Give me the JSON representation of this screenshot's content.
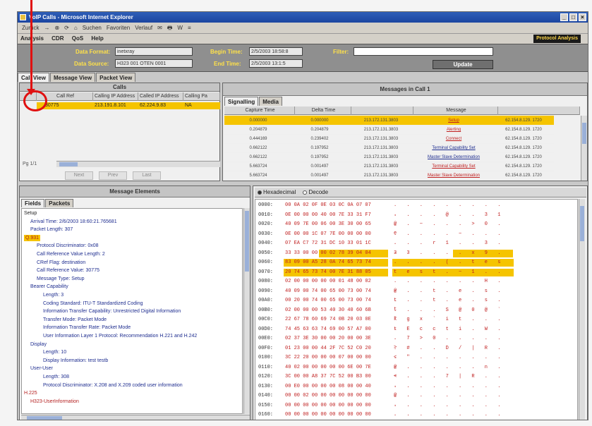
{
  "window": {
    "title": "VoIP Calls - Microsoft Internet Explorer",
    "controls": [
      "_",
      "□",
      "×"
    ]
  },
  "ie_toolbar": {
    "items": [
      "Zurück",
      "→",
      "⊗",
      "⟳",
      "⌂",
      "Suchen",
      "Favoriten",
      "Verlauf",
      "✉",
      "🖶",
      "W",
      "≡"
    ]
  },
  "menu": {
    "items": [
      "Analysis",
      "CDR",
      "QoS",
      "Help"
    ]
  },
  "brand": "Protocol Analysis",
  "filter": {
    "data_format_label": "Data Format:",
    "data_format_value": "inetxray",
    "data_source_label": "Data Source:",
    "data_source_value": "H323 001 OTEN 0001",
    "begin_time_label": "Begin Time:",
    "begin_time_value": "2/5/2003 18:58:8",
    "end_time_label": "End Time:",
    "end_time_value": "2/5/2003 13:1:5",
    "filter_label": "Filter:",
    "filter_value": "",
    "update_label": "Update"
  },
  "view_tabs": [
    "Call View",
    "Message View",
    "Packet View"
  ],
  "calls": {
    "title": "Calls",
    "columns": [
      "",
      "Call Ref",
      "Calling IP Address",
      "Called IP Address",
      "Calling Pa"
    ],
    "rows": [
      [
        "",
        "30775",
        "213.191.8.101",
        "62.224.9.83",
        "NA"
      ]
    ],
    "page_label": "Pg 1/1",
    "nav_buttons": [
      "Next",
      "Prev",
      "Last"
    ]
  },
  "messages": {
    "title": "Messages in Call 1",
    "tabs": [
      "Signalling",
      "Media"
    ],
    "columns": [
      "Capture Time",
      "Delta Time",
      "",
      "Message",
      ""
    ],
    "rows": [
      {
        "t": "0.000000",
        "d": "0.000000",
        "src": "213.172.131.3803",
        "msg": "Setup",
        "dst": "62.154.8.129. 1720",
        "color": "#c02020"
      },
      {
        "t": "0.204879",
        "d": "0.204879",
        "src": "213.172.131.3803",
        "msg": "Alerting",
        "dst": "62.154.8.129. 1720",
        "color": "#c02020"
      },
      {
        "t": "0.444169",
        "d": "0.239402",
        "src": "213.172.131.3803",
        "msg": "Connect",
        "dst": "62.154.8.129. 1720",
        "color": "#c02020"
      },
      {
        "t": "0.662122",
        "d": "0.197952",
        "src": "213.172.131.3803",
        "msg": "Terminal Capability Set",
        "dst": "62.154.8.129. 1720",
        "color": "#1e2d8f"
      },
      {
        "t": "0.662122",
        "d": "0.197952",
        "src": "213.172.131.3803",
        "msg": "Master Slave Determination",
        "dst": "62.154.8.129. 1720",
        "color": "#1e2d8f"
      },
      {
        "t": "5.663724",
        "d": "0.001497",
        "src": "213.172.131.3803",
        "msg": "Terminal Capability Set",
        "dst": "62.154.8.129. 1720",
        "color": "#c02020"
      },
      {
        "t": "5.663724",
        "d": "0.001497",
        "src": "213.172.131.3803",
        "msg": "Master Slave Determination",
        "dst": "62.154.8.129. 1720",
        "color": "#c02020"
      }
    ]
  },
  "elements": {
    "title": "Message Elements",
    "tabs": [
      "Fields",
      "Packets"
    ],
    "tree": [
      {
        "indent": 0,
        "text": "Setup",
        "tone": "dark"
      },
      {
        "indent": 1,
        "text": "Arrival Time: 2/6/2003 18:60:21.765681",
        "tone": "blue"
      },
      {
        "indent": 1,
        "text": "Packet Length: 307",
        "tone": "blue"
      },
      {
        "indent": 0,
        "text": "Q.931",
        "tone": "red"
      },
      {
        "indent": 2,
        "text": "Protocol Discriminator: 0x08",
        "tone": "blue"
      },
      {
        "indent": 2,
        "text": "Call Reference Value Length: 2",
        "tone": "blue"
      },
      {
        "indent": 2,
        "text": "CRef Flag: destination",
        "tone": "blue"
      },
      {
        "indent": 2,
        "text": "Call Reference Value: 30775",
        "tone": "blue"
      },
      {
        "indent": 2,
        "text": "Message Type: Setup",
        "tone": "blue"
      },
      {
        "indent": 1,
        "text": "Bearer Capability",
        "tone": "blue"
      },
      {
        "indent": 3,
        "text": "Length: 3",
        "tone": "blue"
      },
      {
        "indent": 3,
        "text": "Coding Standard: ITU-T Standardized Coding",
        "tone": "blue"
      },
      {
        "indent": 3,
        "text": "Information Transfer Capability: Unrestricted Digital Information",
        "tone": "blue"
      },
      {
        "indent": 3,
        "text": "Transfer Mode: Packet Mode",
        "tone": "blue"
      },
      {
        "indent": 3,
        "text": "Information Transfer Rate: Packet Mode",
        "tone": "blue"
      },
      {
        "indent": 3,
        "text": "User Information Layer 1 Protocol: Recommendation H.221 and H.242",
        "tone": "blue"
      },
      {
        "indent": 1,
        "text": "Display",
        "tone": "blue"
      },
      {
        "indent": 3,
        "text": "Length: 10",
        "tone": "blue"
      },
      {
        "indent": 3,
        "text": "Display Information: test testb",
        "tone": "blue"
      },
      {
        "indent": 1,
        "text": "User-User",
        "tone": "blue"
      },
      {
        "indent": 3,
        "text": "Length: 308",
        "tone": "blue"
      },
      {
        "indent": 3,
        "text": "Protocol Discriminator: X.208 and X.209 coded user information",
        "tone": "blue"
      },
      {
        "indent": 0,
        "text": "H.225",
        "tone": "red"
      },
      {
        "indent": 1,
        "text": "H323-UserInformation",
        "tone": "red"
      }
    ]
  },
  "hexview": {
    "radios": [
      "Hexadecimal",
      "Decode"
    ],
    "lines": [
      {
        "off": "0000:",
        "hx": "00 0A 02 0F 0E 03 0C 0A 07 07",
        "asc": ". . . . . . . . . ."
      },
      {
        "off": "0010:",
        "hx": "0E 00 00 00 40 00 7E 33 31 F7",
        "asc": ". . . . @ . . 3 1 ."
      },
      {
        "off": "0020:",
        "hx": "40 09 7E 00 06 00 3E 30 00 65",
        "asc": "@ . ~ . . . > 0 . e"
      },
      {
        "off": "0030:",
        "hx": "0E 00 00 1C 07 7E 00 00 00 00",
        "asc": ". . . . . ~ . . . ."
      },
      {
        "off": "0040:",
        "hx": "07 EA C7 72 31 DC 10 33 01 1C",
        "asc": ". . . r 1 . . 3 . ."
      },
      {
        "off": "0050:",
        "hx": "33 33 00 00 00 02 78 39 04 04",
        "asc": "3 3 . . . . x 9 . ."
      },
      {
        "off": "0060:",
        "hx": "83 09 00 A5 28 0A 74 65 73 74",
        "asc": ". . . . ( . t e s t"
      },
      {
        "off": "0070:",
        "hx": "20 74 65 73 74 00 7E 31 88 05",
        "asc": "  t e s t . ~ 1 . ."
      },
      {
        "off": "0080:",
        "hx": "02 00 00 00 00 00 01 48 00 02",
        "asc": ". . . . . . . H . ."
      },
      {
        "off": "0090:",
        "hx": "40 09 00 74 00 65 00 73 00 74",
        "asc": "@ . . t . e . s . t"
      },
      {
        "off": "00A0:",
        "hx": "00 20 00 74 00 65 00 73 00 74",
        "asc": ". . . t . e . s . t"
      },
      {
        "off": "00B0:",
        "hx": "02 00 00 00 53 40 30 40 60 6B",
        "asc": ". . . . S @ 0 @ ` k"
      },
      {
        "off": "00C0:",
        "hx": "22 67 78 60 69 74 0B 20 03 0E",
        "asc": "\" g x ` i t . . . ."
      },
      {
        "off": "00D0:",
        "hx": "74 45 63 63 74 69 00 57 A7 00",
        "asc": "t E c c t i . W . ."
      },
      {
        "off": "00E0:",
        "hx": "02 37 3E 30 00 00 20 00 00 3E",
        "asc": ". 7 > 0 . . . . . >"
      },
      {
        "off": "00F0:",
        "hx": "01 23 00 00 44 2F 7C 52 C0 20",
        "asc": ". # . . D / | R . ."
      },
      {
        "off": "0100:",
        "hx": "3C 22 20 00 00 00 07 00 00 00",
        "asc": "< \" . . . . . . . ."
      },
      {
        "off": "0110:",
        "hx": "40 02 00 00 00 00 00 6E 00 7E",
        "asc": "@ . . . . . . n . ~"
      },
      {
        "off": "0120:",
        "hx": "3C 00 00 A8 37 7C 52 00 B3 00",
        "asc": "< . . . 7 | R . . ."
      },
      {
        "off": "0130:",
        "hx": "00 E0 00 00 00 00 08 00 00 40",
        "asc": ". . . . . . . . . @"
      },
      {
        "off": "0140:",
        "hx": "00 00 02 00 00 00 00 00 00 00",
        "asc": ". . . . . . . . . ."
      },
      {
        "off": "0150:",
        "hx": "00 00 00 00 00 00 00 00 00 00",
        "asc": ". . . . . . . . . ."
      },
      {
        "off": "0160:",
        "hx": "00 00 00 00 00 00 00 00 00 00",
        "asc": ". . . . . . . . . ."
      }
    ]
  }
}
